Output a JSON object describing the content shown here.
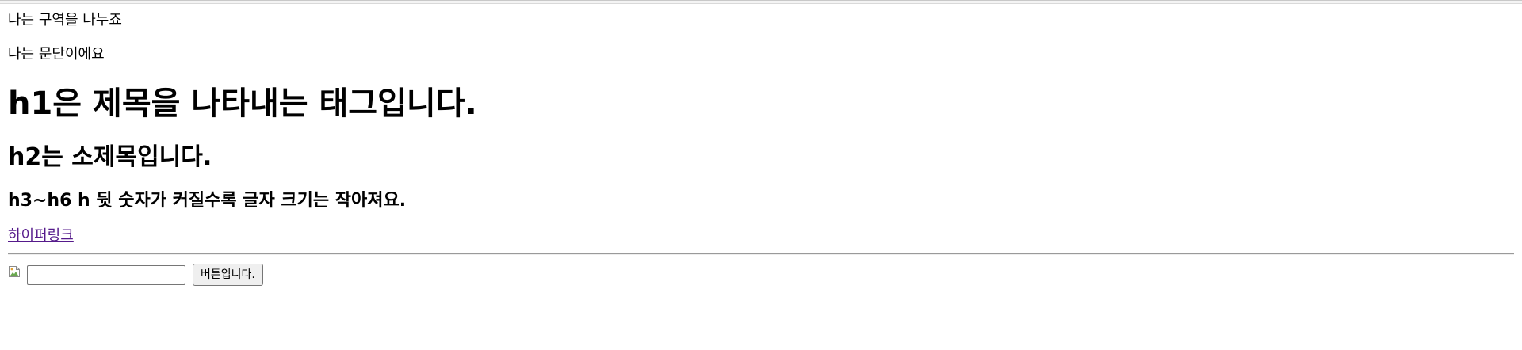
{
  "div_text": "나는 구역을 나누죠",
  "paragraph_text": "나는 문단이에요",
  "heading1": "h1은 제목을 나타내는 태그입니다.",
  "heading2": "h2는 소제목입니다.",
  "heading3": "h3~h6 h 뒷 숫자가 커질수록 글자 크기는 작아져요.",
  "link_text": "하이퍼링크",
  "input": {
    "value": "",
    "placeholder": ""
  },
  "button_label": "버튼입니다.",
  "broken_image_icon": "broken-image-icon",
  "colors": {
    "visited_link": "#551a8b",
    "text": "#000000",
    "background": "#ffffff"
  }
}
